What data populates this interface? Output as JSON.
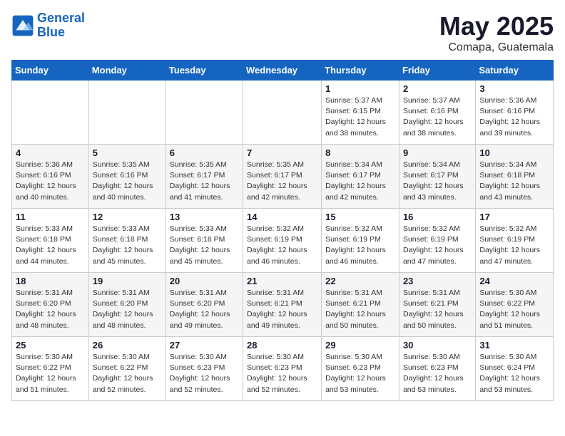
{
  "logo": {
    "line1": "General",
    "line2": "Blue"
  },
  "title": "May 2025",
  "location": "Comapa, Guatemala",
  "days_of_week": [
    "Sunday",
    "Monday",
    "Tuesday",
    "Wednesday",
    "Thursday",
    "Friday",
    "Saturday"
  ],
  "weeks": [
    [
      {
        "day": "",
        "info": ""
      },
      {
        "day": "",
        "info": ""
      },
      {
        "day": "",
        "info": ""
      },
      {
        "day": "",
        "info": ""
      },
      {
        "day": "1",
        "info": "Sunrise: 5:37 AM\nSunset: 6:15 PM\nDaylight: 12 hours\nand 38 minutes."
      },
      {
        "day": "2",
        "info": "Sunrise: 5:37 AM\nSunset: 6:16 PM\nDaylight: 12 hours\nand 38 minutes."
      },
      {
        "day": "3",
        "info": "Sunrise: 5:36 AM\nSunset: 6:16 PM\nDaylight: 12 hours\nand 39 minutes."
      }
    ],
    [
      {
        "day": "4",
        "info": "Sunrise: 5:36 AM\nSunset: 6:16 PM\nDaylight: 12 hours\nand 40 minutes."
      },
      {
        "day": "5",
        "info": "Sunrise: 5:35 AM\nSunset: 6:16 PM\nDaylight: 12 hours\nand 40 minutes."
      },
      {
        "day": "6",
        "info": "Sunrise: 5:35 AM\nSunset: 6:17 PM\nDaylight: 12 hours\nand 41 minutes."
      },
      {
        "day": "7",
        "info": "Sunrise: 5:35 AM\nSunset: 6:17 PM\nDaylight: 12 hours\nand 42 minutes."
      },
      {
        "day": "8",
        "info": "Sunrise: 5:34 AM\nSunset: 6:17 PM\nDaylight: 12 hours\nand 42 minutes."
      },
      {
        "day": "9",
        "info": "Sunrise: 5:34 AM\nSunset: 6:17 PM\nDaylight: 12 hours\nand 43 minutes."
      },
      {
        "day": "10",
        "info": "Sunrise: 5:34 AM\nSunset: 6:18 PM\nDaylight: 12 hours\nand 43 minutes."
      }
    ],
    [
      {
        "day": "11",
        "info": "Sunrise: 5:33 AM\nSunset: 6:18 PM\nDaylight: 12 hours\nand 44 minutes."
      },
      {
        "day": "12",
        "info": "Sunrise: 5:33 AM\nSunset: 6:18 PM\nDaylight: 12 hours\nand 45 minutes."
      },
      {
        "day": "13",
        "info": "Sunrise: 5:33 AM\nSunset: 6:18 PM\nDaylight: 12 hours\nand 45 minutes."
      },
      {
        "day": "14",
        "info": "Sunrise: 5:32 AM\nSunset: 6:19 PM\nDaylight: 12 hours\nand 46 minutes."
      },
      {
        "day": "15",
        "info": "Sunrise: 5:32 AM\nSunset: 6:19 PM\nDaylight: 12 hours\nand 46 minutes."
      },
      {
        "day": "16",
        "info": "Sunrise: 5:32 AM\nSunset: 6:19 PM\nDaylight: 12 hours\nand 47 minutes."
      },
      {
        "day": "17",
        "info": "Sunrise: 5:32 AM\nSunset: 6:19 PM\nDaylight: 12 hours\nand 47 minutes."
      }
    ],
    [
      {
        "day": "18",
        "info": "Sunrise: 5:31 AM\nSunset: 6:20 PM\nDaylight: 12 hours\nand 48 minutes."
      },
      {
        "day": "19",
        "info": "Sunrise: 5:31 AM\nSunset: 6:20 PM\nDaylight: 12 hours\nand 48 minutes."
      },
      {
        "day": "20",
        "info": "Sunrise: 5:31 AM\nSunset: 6:20 PM\nDaylight: 12 hours\nand 49 minutes."
      },
      {
        "day": "21",
        "info": "Sunrise: 5:31 AM\nSunset: 6:21 PM\nDaylight: 12 hours\nand 49 minutes."
      },
      {
        "day": "22",
        "info": "Sunrise: 5:31 AM\nSunset: 6:21 PM\nDaylight: 12 hours\nand 50 minutes."
      },
      {
        "day": "23",
        "info": "Sunrise: 5:31 AM\nSunset: 6:21 PM\nDaylight: 12 hours\nand 50 minutes."
      },
      {
        "day": "24",
        "info": "Sunrise: 5:30 AM\nSunset: 6:22 PM\nDaylight: 12 hours\nand 51 minutes."
      }
    ],
    [
      {
        "day": "25",
        "info": "Sunrise: 5:30 AM\nSunset: 6:22 PM\nDaylight: 12 hours\nand 51 minutes."
      },
      {
        "day": "26",
        "info": "Sunrise: 5:30 AM\nSunset: 6:22 PM\nDaylight: 12 hours\nand 52 minutes."
      },
      {
        "day": "27",
        "info": "Sunrise: 5:30 AM\nSunset: 6:23 PM\nDaylight: 12 hours\nand 52 minutes."
      },
      {
        "day": "28",
        "info": "Sunrise: 5:30 AM\nSunset: 6:23 PM\nDaylight: 12 hours\nand 52 minutes."
      },
      {
        "day": "29",
        "info": "Sunrise: 5:30 AM\nSunset: 6:23 PM\nDaylight: 12 hours\nand 53 minutes."
      },
      {
        "day": "30",
        "info": "Sunrise: 5:30 AM\nSunset: 6:23 PM\nDaylight: 12 hours\nand 53 minutes."
      },
      {
        "day": "31",
        "info": "Sunrise: 5:30 AM\nSunset: 6:24 PM\nDaylight: 12 hours\nand 53 minutes."
      }
    ]
  ]
}
